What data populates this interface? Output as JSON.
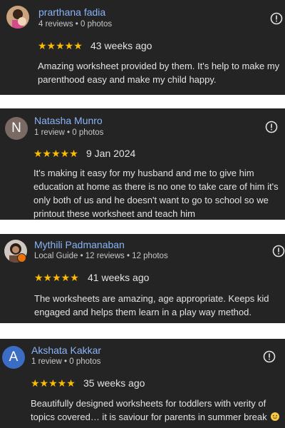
{
  "reviews": [
    {
      "name": "prarthana fadia",
      "meta": "4 reviews • 0 photos",
      "stars": "★★★★★",
      "date": "43 weeks ago",
      "text_lines": [
        "Amazing worksheet provided by them. It's help to make my",
        "parenthood easy and make my child happy."
      ],
      "avatar": "photo-avatar"
    },
    {
      "name": "Natasha Munro",
      "meta": "1 review • 0 photos",
      "stars": "★★★★★",
      "date": "9 Jan 2024",
      "text_lines": [
        "It's making it easy for my husband and me to give him",
        "education at home as there is no one to take care of him it's",
        "only both of us and he doesn't want to go to school so we",
        "printout these worksheet and teach him"
      ],
      "avatar_letter": "N",
      "avatar_color": "#7b6a63"
    },
    {
      "name": "Mythili Padmanaban",
      "meta": "Local Guide • 12 reviews • 12 photos",
      "stars": "★★★★★",
      "date": "41 weeks ago",
      "text_lines": [
        "The worksheets are amazing, age appropriate. Keeps kid",
        "engaged and helps them learn in a play way method."
      ],
      "avatar": "photo-avatar",
      "badge": "local-guide-badge"
    },
    {
      "name": "Akshata Kakkar",
      "meta": "1 review • 0 photos",
      "stars": "★★★★★",
      "date": "35 weeks ago",
      "text_lines": [
        "Beautifully designed worksheets for toddlers with verity of",
        "topics covered… it is saviour for parents in summer break"
      ],
      "avatar_letter": "A",
      "avatar_color": "#3c6dc5",
      "trailing_emoji": "smiling-face-emoji"
    }
  ],
  "colors": {
    "card_bg": "#242424",
    "name": "#8ab4f8",
    "stars": "#fbbc04"
  },
  "icons": {
    "more": "info-circle-icon"
  }
}
